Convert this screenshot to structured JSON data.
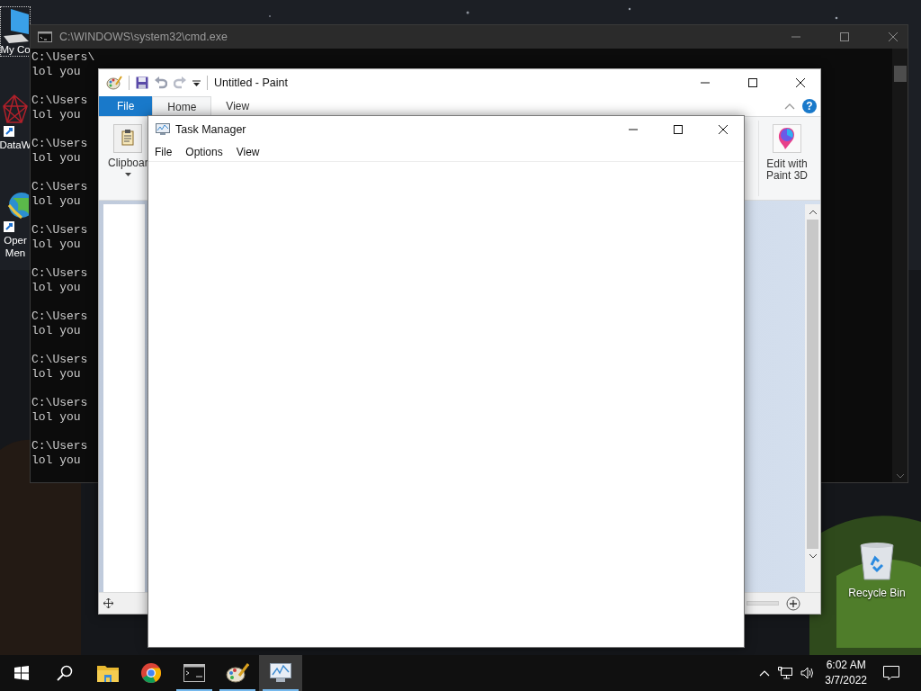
{
  "desktop_icons": [
    {
      "kind": "computer",
      "label": [
        "My Co"
      ],
      "selected": true
    },
    {
      "kind": "data",
      "label": [
        "DataW"
      ],
      "selected": false
    },
    {
      "kind": "globe",
      "label": [
        "Oper",
        "Men"
      ],
      "selected": false
    }
  ],
  "cmd": {
    "title": "C:\\WINDOWS\\system32\\cmd.exe",
    "entries": [
      {
        "prompt": "C:\\Users\\",
        "output": "lol you"
      },
      {
        "prompt": "C:\\Users",
        "output": "lol you"
      },
      {
        "prompt": "C:\\Users",
        "output": "lol you"
      },
      {
        "prompt": "C:\\Users",
        "output": "lol you"
      },
      {
        "prompt": "C:\\Users",
        "output": "lol you"
      },
      {
        "prompt": "C:\\Users",
        "output": "lol you"
      },
      {
        "prompt": "C:\\Users",
        "output": "lol you"
      },
      {
        "prompt": "C:\\Users",
        "output": "lol you"
      },
      {
        "prompt": "C:\\Users",
        "output": "lol you"
      },
      {
        "prompt": "C:\\Users",
        "output": "lol you"
      }
    ]
  },
  "paint": {
    "title": "Untitled - Paint",
    "tabs": [
      {
        "label": "File",
        "kind": "file",
        "selected": false
      },
      {
        "label": "Home",
        "kind": "tab",
        "selected": true
      },
      {
        "label": "View",
        "kind": "tab",
        "selected": false
      }
    ],
    "help": "?",
    "clipboard_label": "Clipboar",
    "paint3d_label": [
      "Edit with",
      "Paint 3D"
    ]
  },
  "task_manager": {
    "title": "Task Manager",
    "menu": [
      "File",
      "Options",
      "View"
    ]
  },
  "recycle_bin": {
    "label": "Recycle Bin"
  },
  "taskbar": {
    "apps": [
      {
        "kind": "explorer",
        "running": false,
        "selected": false
      },
      {
        "kind": "chrome",
        "running": false,
        "selected": false
      },
      {
        "kind": "cmd",
        "running": true,
        "selected": false
      },
      {
        "kind": "paint",
        "running": true,
        "selected": false
      },
      {
        "kind": "taskmgr",
        "running": true,
        "selected": true
      }
    ],
    "clock": {
      "time": "6:02 AM",
      "date": "3/7/2022"
    }
  }
}
